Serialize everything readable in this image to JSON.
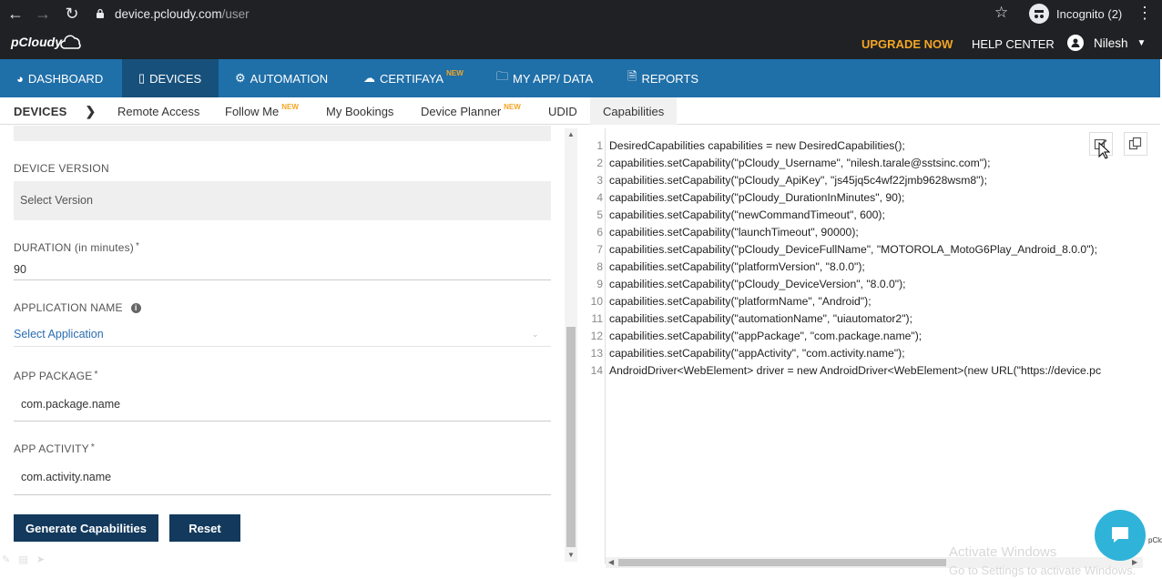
{
  "browser": {
    "url_host": "device.pcloudy.com",
    "url_path": "/user",
    "incognito_label": "Incognito (2)"
  },
  "header": {
    "logo": "pCloudy",
    "upgrade": "UPGRADE NOW",
    "help": "HELP CENTER",
    "user": "Nilesh"
  },
  "mainnav": {
    "items": [
      {
        "label": "DASHBOARD",
        "icon": "gauge-icon"
      },
      {
        "label": "DEVICES",
        "icon": "mobile-icon"
      },
      {
        "label": "AUTOMATION",
        "icon": "gears-icon"
      },
      {
        "label": "CERTIFAYA",
        "icon": "cloud-icon",
        "badge": "NEW"
      },
      {
        "label": "MY APP/ DATA",
        "icon": "folder-icon"
      },
      {
        "label": "REPORTS",
        "icon": "document-icon"
      }
    ]
  },
  "subnav": {
    "title": "DEVICES",
    "items": [
      {
        "label": "Remote Access"
      },
      {
        "label": "Follow Me",
        "badge": "NEW"
      },
      {
        "label": "My Bookings"
      },
      {
        "label": "Device Planner",
        "badge": "NEW"
      },
      {
        "label": "UDID"
      },
      {
        "label": "Capabilities"
      }
    ]
  },
  "form": {
    "device_version_label": "DEVICE VERSION",
    "device_version_placeholder": "Select Version",
    "duration_label": "DURATION (in minutes)",
    "duration_value": "90",
    "app_name_label": "APPLICATION NAME",
    "app_name_placeholder": "Select Application",
    "app_package_label": "APP PACKAGE",
    "app_package_value": "com.package.name",
    "app_activity_label": "APP ACTIVITY",
    "app_activity_value": "com.activity.name",
    "required_mark": "*",
    "generate_button": "Generate Capabilities",
    "reset_button": "Reset"
  },
  "code": {
    "lines": [
      {
        "n": "1",
        "text": "DesiredCapabilities capabilities = new DesiredCapabilities();"
      },
      {
        "n": "2",
        "text": "capabilities.setCapability(\"pCloudy_Username\", \"nilesh.tarale@sstsinc.com\");"
      },
      {
        "n": "3",
        "text": "capabilities.setCapability(\"pCloudy_ApiKey\", \"js45jq5c4wf22jmb9628wsm8\");"
      },
      {
        "n": "4",
        "text": "capabilities.setCapability(\"pCloudy_DurationInMinutes\", 90);"
      },
      {
        "n": "5",
        "text": "capabilities.setCapability(\"newCommandTimeout\", 600);"
      },
      {
        "n": "6",
        "text": "capabilities.setCapability(\"launchTimeout\", 90000);"
      },
      {
        "n": "7",
        "text": "capabilities.setCapability(\"pCloudy_DeviceFullName\", \"MOTOROLA_MotoG6Play_Android_8.0.0\");"
      },
      {
        "n": "8",
        "text": "capabilities.setCapability(\"platformVersion\", \"8.0.0\");"
      },
      {
        "n": "9",
        "text": "capabilities.setCapability(\"pCloudy_DeviceVersion\", \"8.0.0\");"
      },
      {
        "n": "10",
        "text": "capabilities.setCapability(\"platformName\", \"Android\");"
      },
      {
        "n": "11",
        "text": "capabilities.setCapability(\"automationName\", \"uiautomator2\");"
      },
      {
        "n": "12",
        "text": "capabilities.setCapability(\"appPackage\", \"com.package.name\");"
      },
      {
        "n": "13",
        "text": "capabilities.setCapability(\"appActivity\", \"com.activity.name\");"
      },
      {
        "n": "14",
        "text": "AndroidDriver<WebElement> driver = new AndroidDriver<WebElement>(new URL(\"https://device.pc"
      }
    ]
  },
  "overlay": {
    "watermark_line1": "Activate Windows",
    "watermark_line2": "Go to Settings to activate Windows.",
    "tiny_logo": "pClo"
  }
}
